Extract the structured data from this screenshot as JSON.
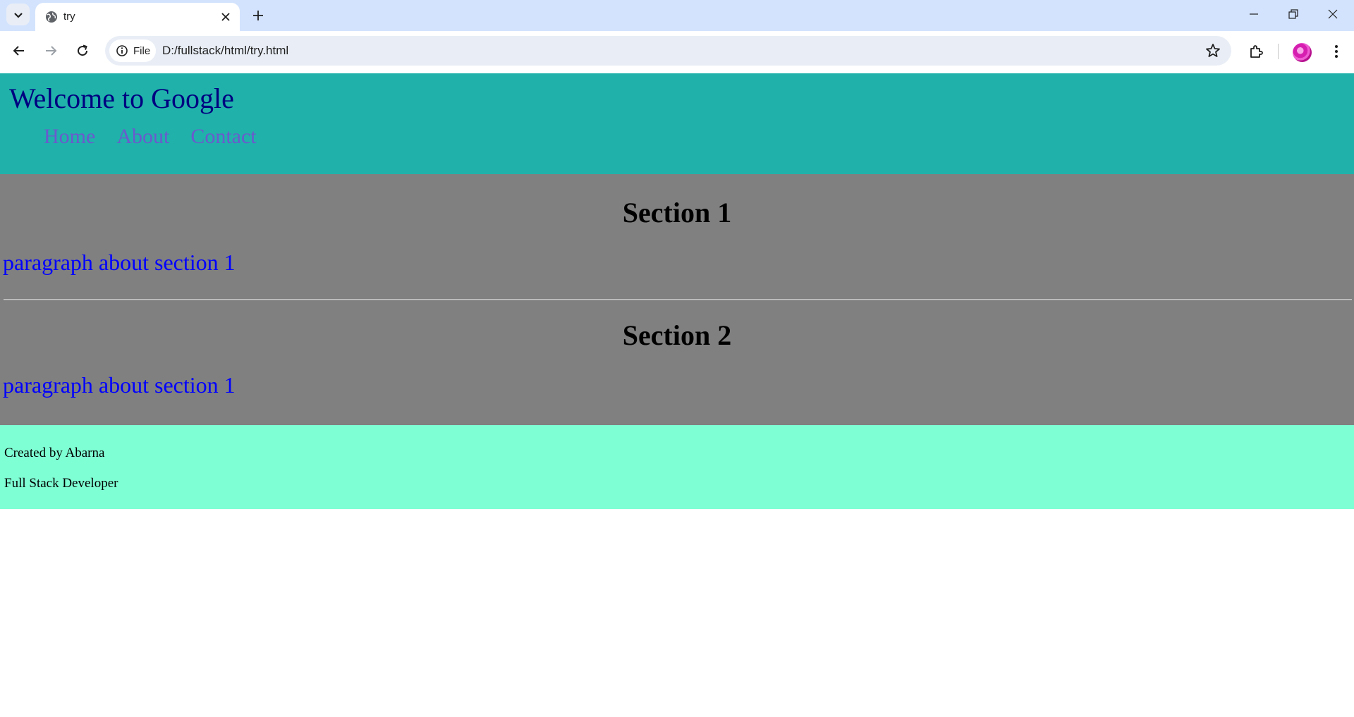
{
  "browser": {
    "tab_title": "try",
    "omnibox_chip_label": "File",
    "url": "D:/fullstack/html/try.html"
  },
  "header": {
    "title": "Welcome to Google",
    "nav": [
      {
        "label": "Home"
      },
      {
        "label": "About"
      },
      {
        "label": "Contact"
      }
    ]
  },
  "sections": [
    {
      "heading": "Section 1",
      "paragraph": "paragraph about section 1"
    },
    {
      "heading": "Section 2",
      "paragraph": "paragraph about section 1"
    }
  ],
  "footer": {
    "line1": "Created by Abarna",
    "line2": "Full Stack Developer"
  },
  "colors": {
    "header_bg": "#20b2aa",
    "title_color": "#000080",
    "nav_link_color": "#6a5acd",
    "main_bg": "#808080",
    "paragraph_color": "#0000ff",
    "footer_bg": "#7fffd4"
  },
  "icons": [
    "tab-search-icon",
    "globe-icon",
    "close-icon",
    "plus-icon",
    "minimize-icon",
    "restore-icon",
    "window-close-icon",
    "back-icon",
    "forward-icon",
    "reload-icon",
    "info-icon",
    "star-icon",
    "extensions-icon",
    "avatar",
    "kebab-menu-icon"
  ]
}
